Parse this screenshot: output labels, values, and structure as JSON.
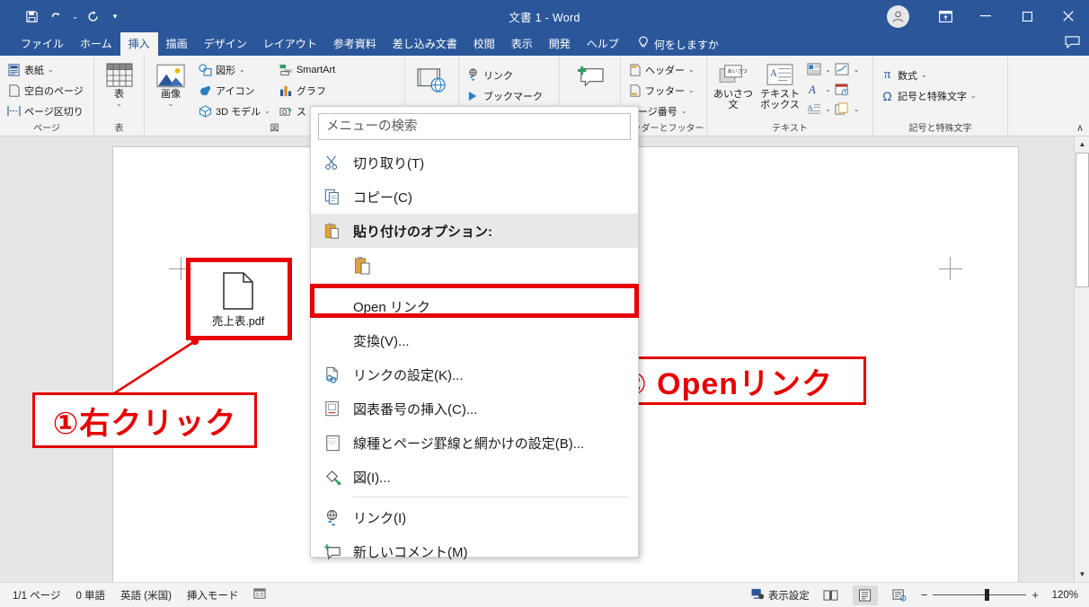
{
  "titlebar": {
    "document_title": "文書 1  -  Word",
    "qat": [
      {
        "name": "save",
        "label": "上書き保存"
      },
      {
        "name": "undo",
        "label": "元に戻す"
      },
      {
        "name": "redo",
        "label": "やり直し"
      },
      {
        "name": "customize",
        "label": "クイック アクセス ツール バーのユーザー設定"
      }
    ],
    "account_label": "アカウント",
    "ribbon_display_label": "リボンの表示オプション",
    "minimize_label": "最小化",
    "maximize_label": "最大化",
    "close_label": "閉じる"
  },
  "tabs": [
    {
      "label": "ファイル",
      "active": false
    },
    {
      "label": "ホーム",
      "active": false
    },
    {
      "label": "挿入",
      "active": true
    },
    {
      "label": "描画",
      "active": false
    },
    {
      "label": "デザイン",
      "active": false
    },
    {
      "label": "レイアウト",
      "active": false
    },
    {
      "label": "参考資料",
      "active": false
    },
    {
      "label": "差し込み文書",
      "active": false
    },
    {
      "label": "校閲",
      "active": false
    },
    {
      "label": "表示",
      "active": false
    },
    {
      "label": "開発",
      "active": false
    },
    {
      "label": "ヘルプ",
      "active": false
    }
  ],
  "tellme": "何をしますか",
  "comments_label": "コメント",
  "ribbon": {
    "collapse_label": "∧",
    "groups": [
      {
        "name": "page",
        "label": "ページ",
        "items": [
          {
            "label": "表紙",
            "chevron": "⌄"
          },
          {
            "label": "空白のページ",
            "chevron": ""
          },
          {
            "label": "ページ区切り",
            "chevron": ""
          }
        ]
      },
      {
        "name": "table",
        "label": "表",
        "big": [
          {
            "label": "表",
            "chevron": "⌄"
          }
        ]
      },
      {
        "name": "illustrations",
        "label": "図",
        "big": [
          {
            "label": "画像",
            "chevron": "⌄"
          }
        ],
        "items": [
          {
            "label": "図形",
            "chevron": "⌄"
          },
          {
            "label": "アイコン",
            "chevron": ""
          },
          {
            "label": "3D モデル",
            "chevron": "⌄"
          },
          {
            "label": "SmartArt",
            "chevron": ""
          },
          {
            "label": "グラフ",
            "chevron": ""
          },
          {
            "label": "ス",
            "chevron": ""
          }
        ]
      },
      {
        "name": "media",
        "label": "",
        "items": []
      },
      {
        "name": "links",
        "label": "",
        "items": [
          {
            "label": "リンク",
            "chevron": ""
          },
          {
            "label": "ブックマーク",
            "chevron": ""
          }
        ]
      },
      {
        "name": "comments",
        "label": "",
        "items": []
      },
      {
        "name": "header-footer",
        "label": "ヘッダーとフッター",
        "items": [
          {
            "label": "ヘッダー",
            "chevron": "⌄"
          },
          {
            "label": "フッター",
            "chevron": "⌄"
          },
          {
            "label": "ページ番号",
            "chevron": "⌄"
          }
        ]
      },
      {
        "name": "text",
        "label": "テキスト",
        "big": [
          {
            "label": "あいさつ\n文",
            "chevron": "⌄"
          },
          {
            "label": "テキスト\nボックス",
            "chevron": "⌄"
          }
        ]
      },
      {
        "name": "symbols",
        "label": "記号と特殊文字",
        "items": [
          {
            "label": "数式",
            "chevron": "⌄"
          },
          {
            "label": "記号と特殊文字",
            "chevron": "⌄"
          }
        ]
      }
    ]
  },
  "document": {
    "embedded_object": {
      "filename": "売上表.pdf",
      "icon": "pdf-file-icon"
    }
  },
  "context_menu": {
    "search_placeholder": "メニューの検索",
    "search_value": "",
    "items": [
      {
        "name": "cut",
        "icon": "scissors-icon",
        "text": "切り取り(T)",
        "accel": "T",
        "type": "item"
      },
      {
        "name": "copy",
        "icon": "copy-icon",
        "text": "コピー(C)",
        "accel": "C",
        "type": "item"
      },
      {
        "name": "paste-options-header",
        "icon": "clipboard-icon",
        "text": "貼り付けのオプション:",
        "accel": "",
        "type": "header"
      },
      {
        "name": "paste-keep-source",
        "icon": "clipboard-doc-icon",
        "text": "",
        "accel": "",
        "type": "paste-gallery"
      },
      {
        "name": "open-link",
        "icon": "",
        "text": "Open リンク",
        "accel": "O",
        "type": "item",
        "highlighted": true
      },
      {
        "name": "convert",
        "icon": "",
        "text": "変換(V)...",
        "accel": "V",
        "type": "item"
      },
      {
        "name": "link-settings",
        "icon": "link-doc-icon",
        "text": "リンクの設定(K)...",
        "accel": "K",
        "type": "item"
      },
      {
        "name": "insert-caption",
        "icon": "caption-icon",
        "text": "図表番号の挿入(C)...",
        "accel": "C",
        "type": "item"
      },
      {
        "name": "borders-shading",
        "icon": "page-border-icon",
        "text": "線種とページ罫線と網かけの設定(B)...",
        "accel": "B",
        "type": "item"
      },
      {
        "name": "format-picture",
        "icon": "paint-bucket-icon",
        "text": "図(I)...",
        "accel": "I",
        "type": "item"
      },
      {
        "name": "hyperlink",
        "icon": "globe-link-icon",
        "text": "リンク(I)",
        "accel": "I",
        "type": "item"
      },
      {
        "name": "new-comment",
        "icon": "new-comment-icon",
        "text": "新しいコメント(M)",
        "accel": "M",
        "type": "item"
      }
    ]
  },
  "annotations": {
    "step1": "①右クリック",
    "step2": "② Openリンク",
    "accent_color": "#e60000"
  },
  "statusbar": {
    "page": "1/1 ページ",
    "words": "0 単語",
    "language": "英語 (米国)",
    "mode": "挿入モード",
    "accessibility_icon": "accessibility-icon",
    "display_settings": "表示設定",
    "views": [
      {
        "name": "read-mode",
        "label": "閲覧モード",
        "active": false
      },
      {
        "name": "print-layout",
        "label": "印刷レイアウト",
        "active": true
      },
      {
        "name": "web-layout",
        "label": "Web レイアウト",
        "active": false
      }
    ],
    "zoom_out": "−",
    "zoom_in": "+",
    "zoom_value": "120%"
  }
}
